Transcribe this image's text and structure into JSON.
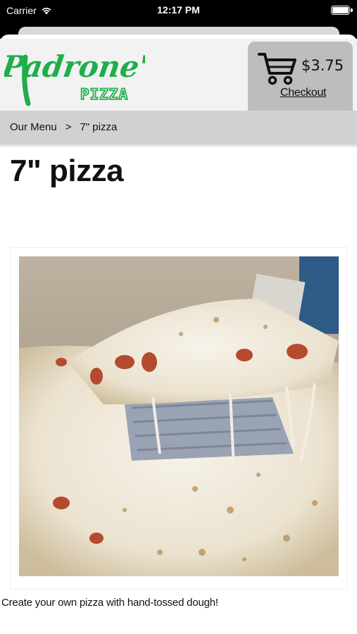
{
  "status_bar": {
    "carrier": "Carrier",
    "time": "12:17 PM"
  },
  "brand": {
    "logo_script": "Padrone's",
    "logo_sub": "PIZZA",
    "logo_color": "#1fae4b"
  },
  "cart": {
    "total": "$3.75",
    "checkout_label": "Checkout"
  },
  "breadcrumb": {
    "items": [
      "Our Menu",
      "7\" pizza"
    ],
    "separator": ">"
  },
  "product": {
    "title": "7\" pizza",
    "description": "Create your own pizza with hand-tossed dough!"
  }
}
